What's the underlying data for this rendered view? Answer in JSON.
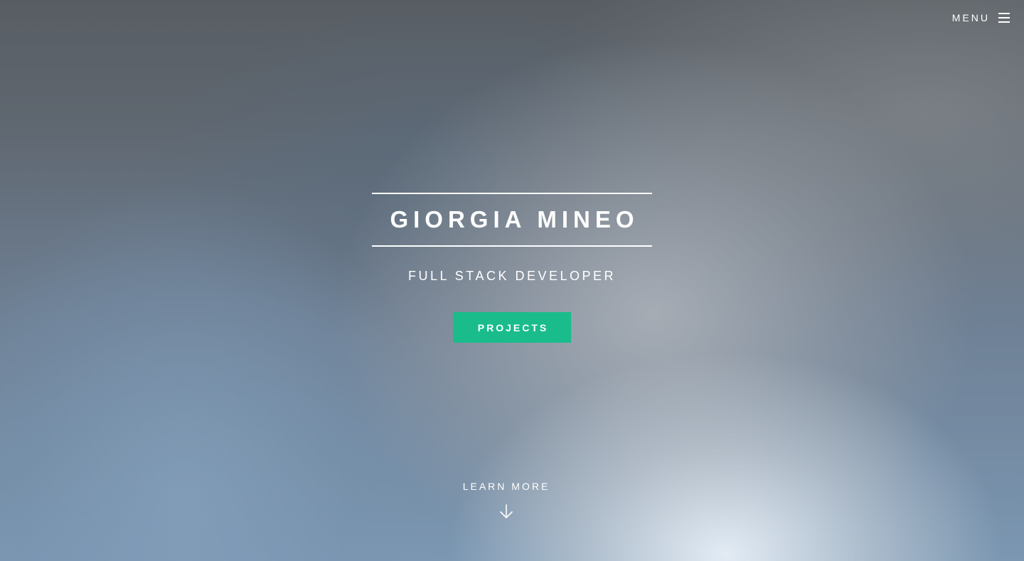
{
  "nav": {
    "menu_label": "MENU",
    "menu_icon": "hamburger-icon"
  },
  "hero": {
    "title": "GIORGIA MINEO",
    "subtitle": "FULL STACK DEVELOPER",
    "cta_label": "PROJECTS",
    "cta_color": "#1abc8c"
  },
  "footer_hint": {
    "label": "LEARN MORE",
    "icon": "arrow-down-icon"
  }
}
